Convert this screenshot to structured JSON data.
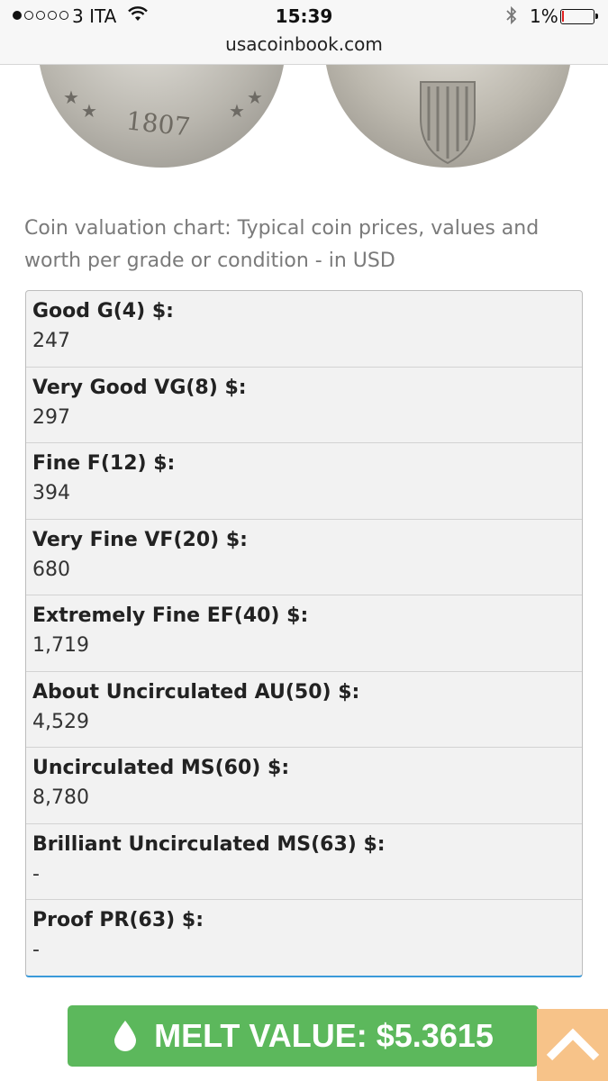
{
  "status_bar": {
    "carrier": "3 ITA",
    "time": "15:39",
    "battery": "1%",
    "battery_level": 0.01
  },
  "browser": {
    "url": "usacoinbook.com"
  },
  "coin": {
    "date": "1807"
  },
  "description": "Coin valuation chart: Typical coin prices, values and worth per grade or condition - in USD",
  "grades": [
    {
      "label": "Good G(4) $:",
      "value": "247"
    },
    {
      "label": "Very Good VG(8) $:",
      "value": "297"
    },
    {
      "label": "Fine F(12) $:",
      "value": "394"
    },
    {
      "label": "Very Fine VF(20) $:",
      "value": "680"
    },
    {
      "label": "Extremely Fine EF(40) $:",
      "value": "1,719"
    },
    {
      "label": "About Uncirculated AU(50) $:",
      "value": "4,529"
    },
    {
      "label": "Uncirculated MS(60) $:",
      "value": "8,780"
    },
    {
      "label": "Brilliant Uncirculated MS(63) $:",
      "value": "-"
    },
    {
      "label": "Proof PR(63) $:",
      "value": "-"
    }
  ],
  "melt_button": {
    "label": "MELT VALUE: $5.3615",
    "color": "#5cb85c",
    "icon": "droplet-icon"
  },
  "to_top": {
    "icon": "chevron-up-icon",
    "color": "#f7c389"
  }
}
